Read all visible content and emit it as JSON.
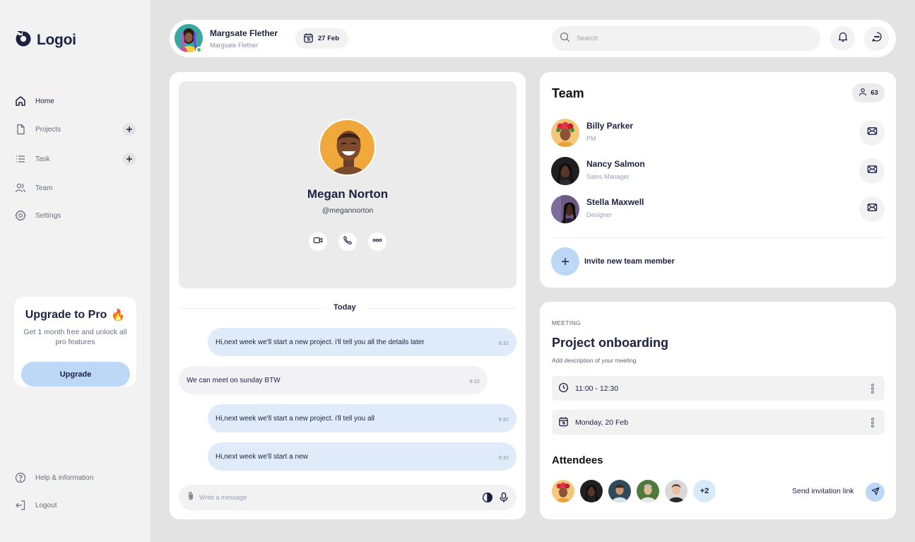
{
  "brand": {
    "name": "Logoi"
  },
  "sidebar": {
    "items": [
      {
        "label": "Home",
        "icon": "home-icon",
        "active": true
      },
      {
        "label": "Projects",
        "icon": "file-icon",
        "has_add": true
      },
      {
        "label": "Task",
        "icon": "list-icon",
        "has_add": true
      },
      {
        "label": "Team",
        "icon": "users-icon"
      },
      {
        "label": "Settings",
        "icon": "gear-icon"
      }
    ],
    "upgrade": {
      "title": "Upgrade to Pro",
      "emoji": "🔥",
      "description": "Get 1 month free and unlock all pro features",
      "button": "Upgrade"
    },
    "footer": [
      {
        "label": "Help & information",
        "icon": "help-icon"
      },
      {
        "label": "Logout",
        "icon": "logout-icon"
      }
    ]
  },
  "topbar": {
    "user_name": "Margsate Flether",
    "user_sub": "Margsate Flether",
    "date": "27 Feb",
    "search_placeholder": "Search"
  },
  "profile": {
    "name": "Megan Norton",
    "handle": "@megannorton"
  },
  "chat": {
    "day_label": "Today",
    "messages": [
      {
        "text": "Hi,next week we'll start a new project. i'll tell you all the details later",
        "time": "9:32",
        "direction": "out"
      },
      {
        "text": "We can meet on sunday BTW",
        "time": "9:32",
        "direction": "in"
      },
      {
        "text": "Hi,next week we'll start a new project. i'll tell you all",
        "time": "9:32",
        "direction": "out"
      },
      {
        "text": "Hi,next week we'll start a new",
        "time": "9:32",
        "direction": "out"
      }
    ],
    "compose_placeholder": "Write a message"
  },
  "team": {
    "title": "Team",
    "count": "63",
    "members": [
      {
        "name": "Billy Parker",
        "role": "PM"
      },
      {
        "name": "Nancy Salmon",
        "role": "Sales Manager"
      },
      {
        "name": "Stella Maxwell",
        "role": "Designer"
      }
    ],
    "invite_label": "Invite new team member"
  },
  "meeting": {
    "kicker": "MEETING",
    "title": "Project onboarding",
    "description": "Add description of your meeting",
    "time": "11:00 - 12:30",
    "date": "Monday, 20 Feb",
    "attendees_title": "Attendees",
    "more_count": "+2",
    "send_link": "Send invitation link"
  },
  "colors": {
    "accent": "#bcd8f6",
    "outgoing_bubble": "#e0ebfa",
    "incoming_bubble": "#f1f1f6",
    "online": "#3bc46d",
    "text_dark": "#1b2140"
  }
}
